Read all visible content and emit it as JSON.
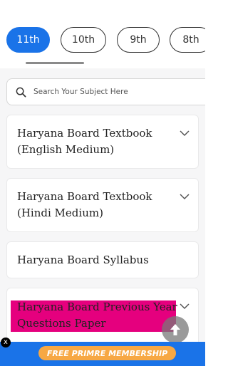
{
  "class_tabs": [
    {
      "label": "11th",
      "active": true
    },
    {
      "label": "10th",
      "active": false
    },
    {
      "label": "9th",
      "active": false
    },
    {
      "label": "8th",
      "active": false
    }
  ],
  "search": {
    "placeholder": "Search Your Subject Here",
    "icon": "search-icon"
  },
  "cards": [
    {
      "title_line1": "Haryana Board Textbook",
      "title_line2": "(English Medium)",
      "expandable": true
    },
    {
      "title_line1": "Haryana Board Textbook",
      "title_line2": "(Hindi Medium)",
      "expandable": true
    },
    {
      "title": "Haryana Board Syllabus",
      "expandable": false
    },
    {
      "title_line1": "Haryana Board Previous Year",
      "title_line2": "Questions Paper",
      "expandable": true,
      "highlight_color": "#e5007e"
    }
  ],
  "promo": {
    "label": "FREE PRIMRE MEMBERSHIP",
    "close_label": "x",
    "button_color": "#f7a844",
    "bar_color": "#1a73e8"
  },
  "colors": {
    "accent": "#1a73e8",
    "background": "#f6f6f7"
  }
}
